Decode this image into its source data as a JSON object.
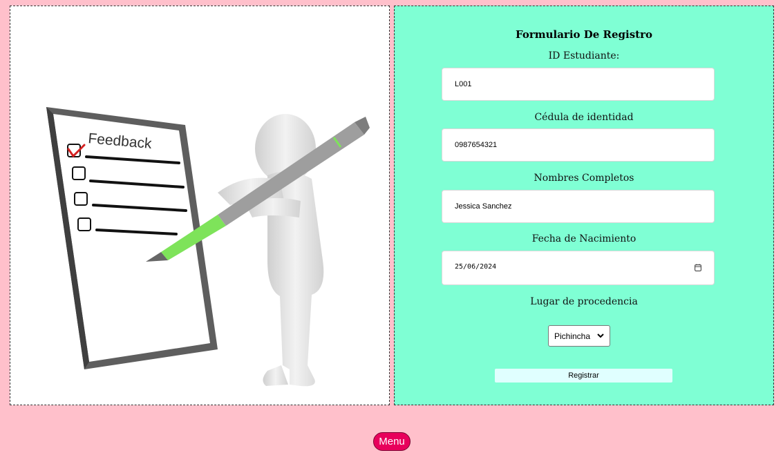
{
  "illustration": {
    "board_heading": "Feedback"
  },
  "form": {
    "title": "Formulario De Registro",
    "fields": {
      "student_id": {
        "label": "ID Estudiante:",
        "value": "L001"
      },
      "cedula": {
        "label": "Cédula de identidad",
        "value": "0987654321"
      },
      "full_name": {
        "label": "Nombres Completos",
        "value": "Jessica Sanchez"
      },
      "birth_date": {
        "label": "Fecha de Nacimiento",
        "value": "25/06/2024"
      },
      "origin": {
        "label": "Lugar de procedencia",
        "value": "Pichincha"
      }
    },
    "submit_label": "Registrar"
  },
  "footer": {
    "menu_label": "Menu"
  },
  "colors": {
    "page_background": "#ffc0cb",
    "form_background": "#7fffd4",
    "submit_background": "#e0ffff",
    "menu_button": "#e8005c"
  }
}
